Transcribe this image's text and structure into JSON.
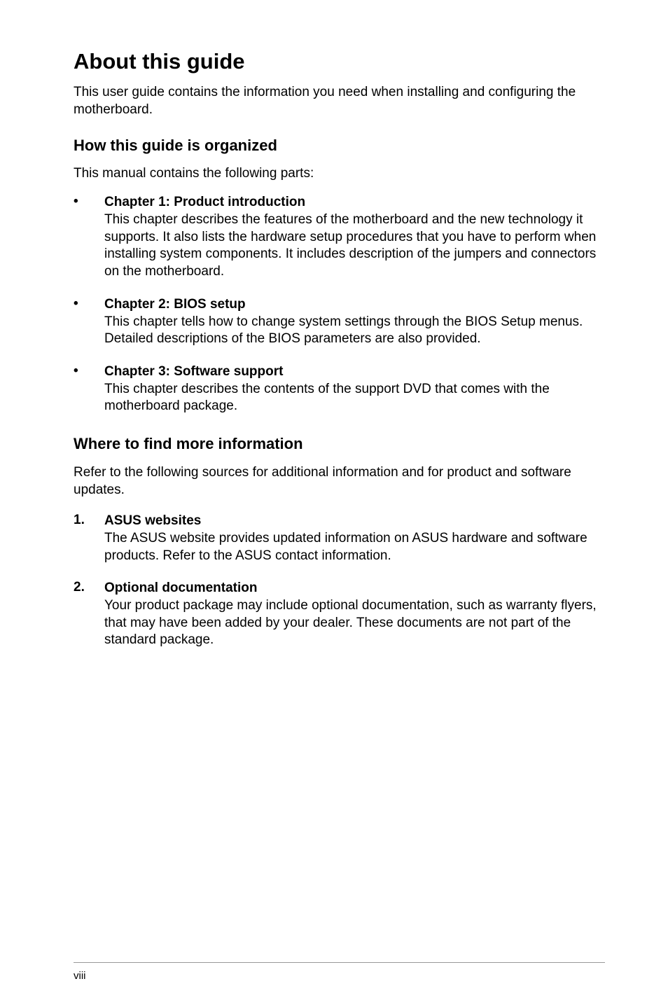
{
  "title": "About this guide",
  "intro": "This user guide contains the information you need when installing and configuring the motherboard.",
  "section1": {
    "heading": "How this guide is organized",
    "intro": "This manual contains the following parts:",
    "items": [
      {
        "title": "Chapter 1: Product introduction",
        "body": "This chapter describes the features of the motherboard and the new technology it supports. It also lists the hardware setup procedures that you have to perform when installing system components. It includes description of the jumpers and connectors on the motherboard."
      },
      {
        "title": "Chapter 2: BIOS setup",
        "body": "This chapter tells how to change system settings through the BIOS Setup menus. Detailed descriptions of the BIOS parameters are also provided."
      },
      {
        "title": "Chapter 3: Software support",
        "body": "This chapter describes the contents of the support DVD that comes with the motherboard package."
      }
    ]
  },
  "section2": {
    "heading": "Where to find more information",
    "intro": "Refer to the following sources for additional information and for product and software updates.",
    "items": [
      {
        "number": "1.",
        "title": "ASUS websites",
        "body": "The ASUS website provides updated information on ASUS hardware and software products. Refer to the ASUS contact information."
      },
      {
        "number": "2.",
        "title": "Optional documentation",
        "body": "Your product package may include optional documentation, such as warranty flyers, that may have been added by your dealer. These documents are not part of the standard package."
      }
    ]
  },
  "page_number": "viii"
}
